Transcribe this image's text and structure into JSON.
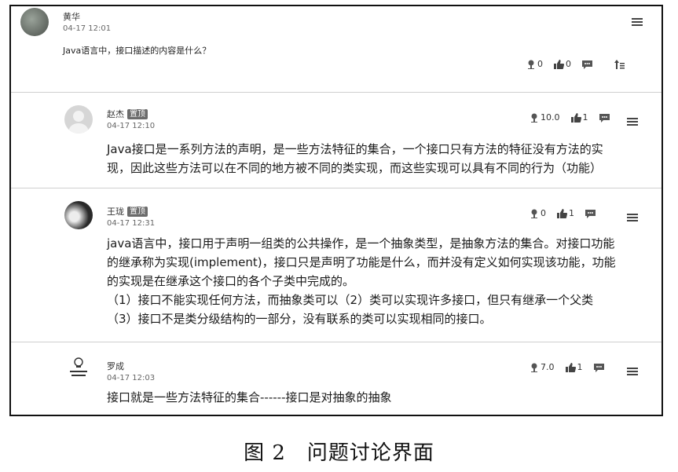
{
  "question": {
    "user": "黄华",
    "time": "04-17 12:01",
    "text": "Java语言中，接口描述的内容是什么？",
    "stats": {
      "rating": "0",
      "likes": "0"
    }
  },
  "pinned_label": "置顶",
  "replies": [
    {
      "user": "赵杰",
      "pinned": true,
      "time": "04-17 12:10",
      "rating": "10.0",
      "likes": "1",
      "lines": [
        "Java接口是一系列方法的声明，是一些方法特征的集合，一个接口只有方法的特征没有方法的实",
        "现，因此这些方法可以在不同的地方被不同的类实现，而这些实现可以具有不同的行为（功能）"
      ]
    },
    {
      "user": "王珑",
      "pinned": true,
      "time": "04-17 12:31",
      "rating": "0",
      "likes": "1",
      "lines": [
        "java语言中，接口用于声明一组类的公共操作，是一个抽象类型，是抽象方法的集合。对接口功能",
        "的继承称为实现(implement)，接口只是声明了功能是什么，而并没有定义如何实现该功能，功能",
        "的实现是在继承这个接口的各个子类中完成的。",
        "（1）接口不能实现任何方法，而抽象类可以（2）类可以实现许多接口，但只有继承一个父类",
        "（3）接口不是类分级结构的一部分，没有联系的类可以实现相同的接口。"
      ]
    },
    {
      "user": "罗成",
      "pinned": false,
      "time": "04-17 12:03",
      "rating": "7.0",
      "likes": "1",
      "lines": [
        "接口就是一些方法特征的集合------接口是对抽象的抽象"
      ]
    }
  ],
  "caption": "图 2　问题讨论界面",
  "colors": {
    "border": "#111111",
    "divider": "#cfcfcf",
    "badge": "#6b6b6b",
    "icon": "#444444"
  }
}
